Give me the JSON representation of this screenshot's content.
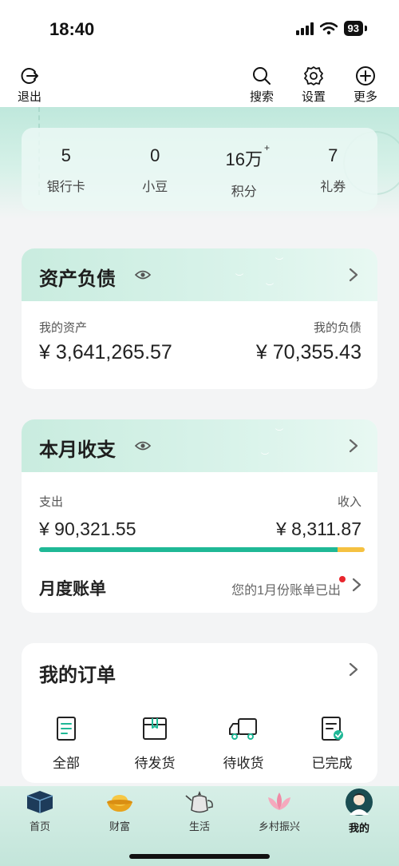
{
  "status": {
    "time": "18:40",
    "battery": "93"
  },
  "topbar": {
    "logout": "退出",
    "search": "搜索",
    "settings": "设置",
    "more": "更多"
  },
  "stats": [
    {
      "value": "5",
      "label": "银行卡"
    },
    {
      "value": "0",
      "label": "小豆"
    },
    {
      "value": "16万",
      "label": "积分",
      "badge": "+"
    },
    {
      "value": "7",
      "label": "礼券"
    }
  ],
  "assets": {
    "title": "资产负债",
    "assets_label": "我的资产",
    "liabilities_label": "我的负债",
    "assets_value": "¥ 3,641,265.57",
    "liabilities_value": "¥ 70,355.43"
  },
  "monthly": {
    "title": "本月收支",
    "expense_label": "支出",
    "income_label": "收入",
    "expense_value": "¥ 90,321.55",
    "income_value": "¥ 8,311.87",
    "expense_share": 0.916,
    "bill_title": "月度账单",
    "bill_note": "您的1月份账单已出"
  },
  "orders": {
    "title": "我的订单",
    "items": [
      {
        "label": "全部",
        "icon": "document-icon"
      },
      {
        "label": "待发货",
        "icon": "package-icon"
      },
      {
        "label": "待收货",
        "icon": "truck-icon"
      },
      {
        "label": "已完成",
        "icon": "completed-icon"
      }
    ]
  },
  "nav": [
    {
      "label": "首页",
      "icon": "book-icon"
    },
    {
      "label": "财富",
      "icon": "gold-ingot-icon"
    },
    {
      "label": "生活",
      "icon": "teapot-icon"
    },
    {
      "label": "乡村振兴",
      "icon": "lotus-icon"
    },
    {
      "label": "我的",
      "icon": "avatar-icon",
      "active": true
    }
  ],
  "colors": {
    "accent": "#1fb896",
    "income": "#f5c141",
    "alert": "#e8262d",
    "header_mint": "#c9ecdf"
  }
}
